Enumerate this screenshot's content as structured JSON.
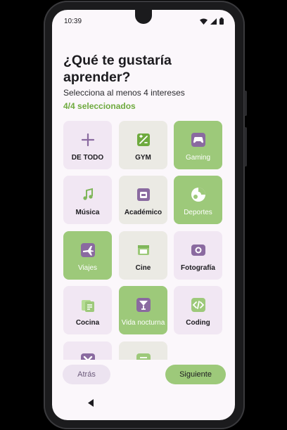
{
  "status_bar": {
    "time": "10:39"
  },
  "header": {
    "title": "¿Qué te gustaría aprender?",
    "subtitle": "Selecciona al menos 4 intereses",
    "count": "4/4 seleccionados"
  },
  "colors": {
    "accent_green": "#9dc97a",
    "tile_purple": "#f1e7f3",
    "tile_grey": "#ebeae4",
    "icon_purple": "#8a6aa0"
  },
  "interests": [
    {
      "label": "DE TODO",
      "icon": "plus-icon",
      "selected": false
    },
    {
      "label": "GYM",
      "icon": "fitness-icon",
      "selected": false
    },
    {
      "label": "Gaming",
      "icon": "gamepad-icon",
      "selected": true
    },
    {
      "label": "Música",
      "icon": "music-note-icon",
      "selected": false
    },
    {
      "label": "Académico",
      "icon": "backpack-icon",
      "selected": false
    },
    {
      "label": "Deportes",
      "icon": "ball-icon",
      "selected": true
    },
    {
      "label": "Viajes",
      "icon": "airplane-icon",
      "selected": true
    },
    {
      "label": "Cine",
      "icon": "movie-icon",
      "selected": false
    },
    {
      "label": "Fotografía",
      "icon": "camera-icon",
      "selected": false
    },
    {
      "label": "Cocina",
      "icon": "recipe-icon",
      "selected": false
    },
    {
      "label": "Vida nocturna",
      "icon": "cocktail-icon",
      "selected": true
    },
    {
      "label": "Coding",
      "icon": "code-icon",
      "selected": false
    },
    {
      "label": "",
      "icon": "cross-icon",
      "selected": false
    },
    {
      "label": "",
      "icon": "list-icon",
      "selected": false
    }
  ],
  "actions": {
    "back_label": "Atrás",
    "next_label": "Siguiente"
  }
}
